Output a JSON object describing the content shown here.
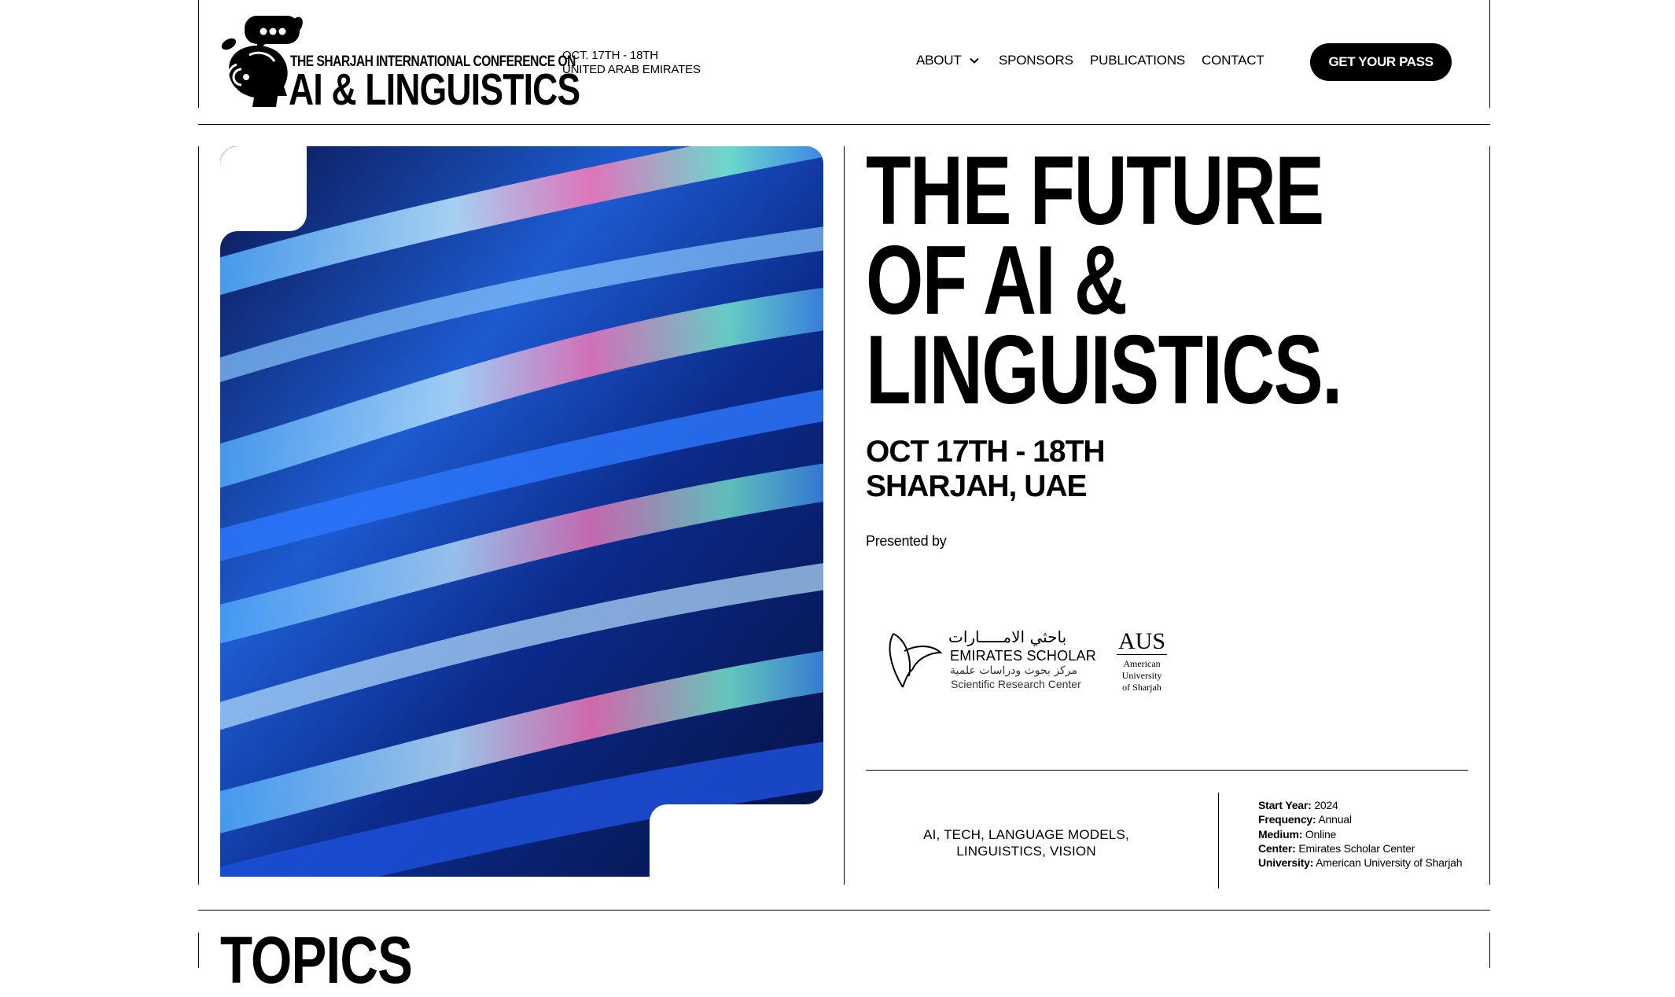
{
  "header": {
    "logo": {
      "line1": "THE SHARJAH INTERNATIONAL CONFERENCE ON",
      "line2": "AI & LINGUISTICS"
    },
    "date_line1": "OCT. 17TH - 18TH",
    "date_line2": "UNITED ARAB EMIRATES",
    "nav": {
      "about": "ABOUT",
      "sponsors": "SPONSORS",
      "publications": "PUBLICATIONS",
      "contact": "CONTACT"
    },
    "cta_label": "GET YOUR PASS"
  },
  "hero": {
    "headline_lines": [
      "THE FUTURE",
      "OF AI &",
      "LINGUISTICS."
    ],
    "date": "OCT 17TH - 18TH",
    "location": "SHARJAH, UAE",
    "presented_by": "Presented by"
  },
  "sponsors": {
    "emirates": {
      "arabic_name": "باحثي الامـــــارات",
      "name": "EMIRATES SCHOLAR",
      "arabic_sub": "مركز بحوث ودراسات علمية",
      "sub": "Scientific Research Center"
    },
    "aus": {
      "abbr": "AUS",
      "line1": "American",
      "line2": "University",
      "line3": "of Sharjah"
    }
  },
  "info": {
    "tags": "AI, TECH, LANGUAGE MODELS, LINGUISTICS, VISION",
    "facts": [
      {
        "key": "Start Year:",
        "value": "2024"
      },
      {
        "key": "Frequency:",
        "value": "Annual"
      },
      {
        "key": "Medium:",
        "value": "Online"
      },
      {
        "key": "Center:",
        "value": "Emirates Scholar Center"
      },
      {
        "key": "University:",
        "value": "American University of Sharjah"
      }
    ]
  },
  "sections": {
    "topics_title": "TOPICS"
  },
  "colors": {
    "ink": "#000000",
    "background": "#ffffff"
  },
  "icons": [
    "logo-mark-icon",
    "chevron-down-icon",
    "emirates-scholar-feather-icon"
  ]
}
